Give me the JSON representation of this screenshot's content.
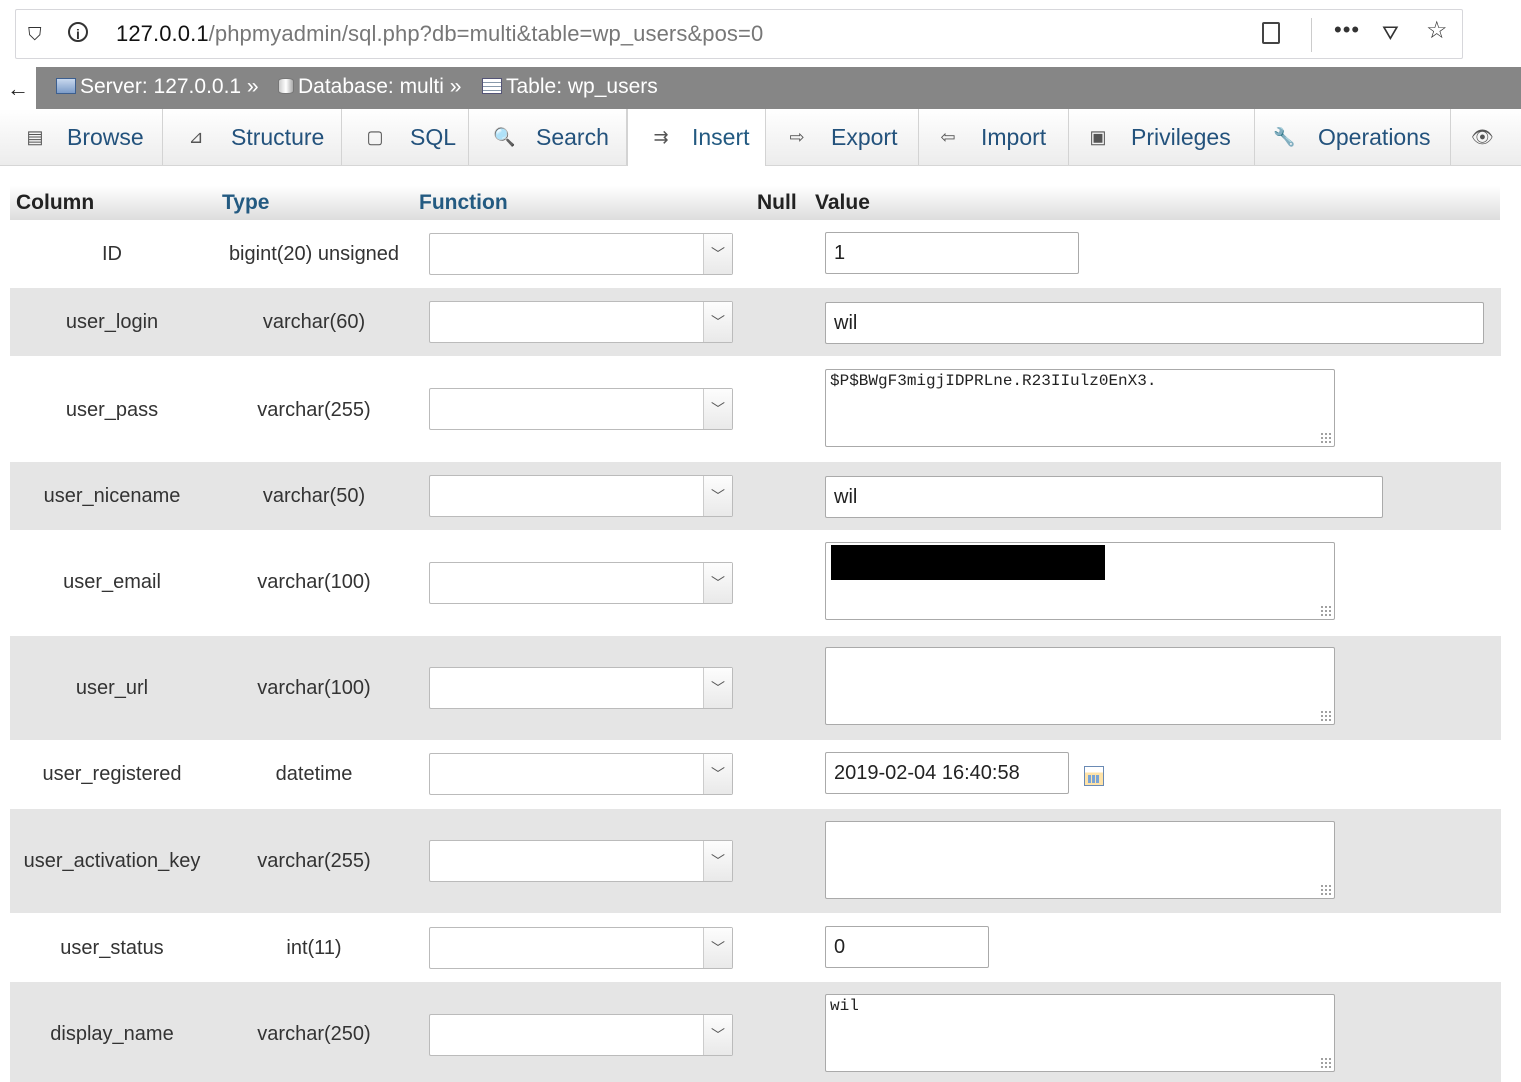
{
  "browser": {
    "url_host": "127.0.0.1",
    "url_path": "/phpmyadmin/sql.php?db=multi&table=wp_users&pos=0",
    "icons": [
      "shield-icon",
      "info-icon",
      "reader-view-icon",
      "more-icon",
      "pocket-icon",
      "bookmark-star-icon"
    ]
  },
  "breadcrumb": {
    "back": "←",
    "server": "Server: 127.0.0.1 »",
    "database": "Database: multi »",
    "table": "Table: wp_users"
  },
  "tabs": [
    {
      "label": "Browse",
      "icon": "▤"
    },
    {
      "label": "Structure",
      "icon": "⊿"
    },
    {
      "label": "SQL",
      "icon": "▢"
    },
    {
      "label": "Search",
      "icon": "🔍"
    },
    {
      "label": "Insert",
      "icon": "⇉"
    },
    {
      "label": "Export",
      "icon": "⇨"
    },
    {
      "label": "Import",
      "icon": "⇦"
    },
    {
      "label": "Privileges",
      "icon": "▣"
    },
    {
      "label": "Operations",
      "icon": "🔧"
    },
    {
      "label": "",
      "icon": "👁"
    }
  ],
  "active_tab": "Insert",
  "table_header": {
    "column": "Column",
    "type": "Type",
    "function": "Function",
    "null": "Null",
    "value": "Value"
  },
  "rows": [
    {
      "name": "ID",
      "type": "bigint(20) unsigned",
      "value": "1",
      "control": "input"
    },
    {
      "name": "user_login",
      "type": "varchar(60)",
      "value": "wil",
      "control": "input"
    },
    {
      "name": "user_pass",
      "type": "varchar(255)",
      "value": "$P$BWgF3migjIDPRLne.R23IIulz0EnX3.",
      "control": "textarea"
    },
    {
      "name": "user_nicename",
      "type": "varchar(50)",
      "value": "wil",
      "control": "input"
    },
    {
      "name": "user_email",
      "type": "varchar(100)",
      "value": "",
      "control": "textarea",
      "redacted": true
    },
    {
      "name": "user_url",
      "type": "varchar(100)",
      "value": "",
      "control": "textarea"
    },
    {
      "name": "user_registered",
      "type": "datetime",
      "value": "2019-02-04 16:40:58",
      "control": "input"
    },
    {
      "name": "user_activation_key",
      "type": "varchar(255)",
      "value": "",
      "control": "textarea"
    },
    {
      "name": "user_status",
      "type": "int(11)",
      "value": "0",
      "control": "input"
    },
    {
      "name": "display_name",
      "type": "varchar(250)",
      "value": "wil",
      "control": "textarea"
    }
  ],
  "colors": {
    "breadcrumb_bg": "#868686",
    "link": "#235a81",
    "row_shade": "#e5e5e5"
  }
}
